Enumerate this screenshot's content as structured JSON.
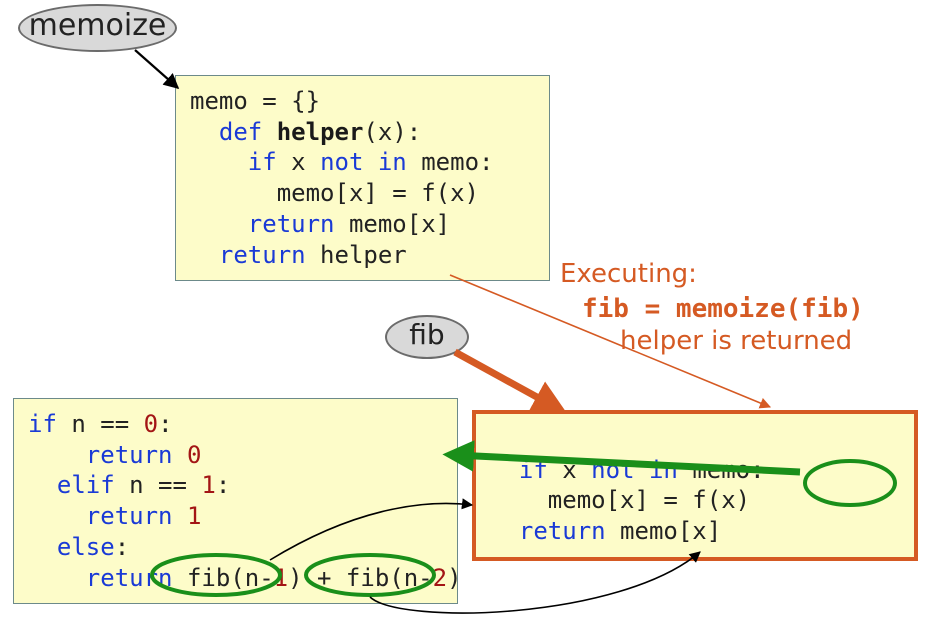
{
  "labels": {
    "memoize": "memoize",
    "fib": "fib"
  },
  "memoize_code": {
    "l1_memo": "memo",
    "l1_eq": " = {}",
    "l2_def": "def",
    "l2_name": "helper",
    "l2_params": "(x):",
    "l3_if": "if",
    "l3_x": " x ",
    "l3_notin": "not in",
    "l3_memo": " memo:",
    "l4": "memo[x] = f(x)",
    "l5_ret": "return",
    "l5_val": " memo[x]",
    "l6_ret": "return",
    "l6_val": " helper"
  },
  "fib_code": {
    "l1_if": "if",
    "l1_rest": " n == ",
    "l1_zero": "0",
    "l1_colon": ":",
    "l2_ret": "return",
    "l2_sp": " ",
    "l2_zero": "0",
    "l3_elif": "elif",
    "l3_rest": " n == ",
    "l3_one": "1",
    "l3_colon": ":",
    "l4_ret": "return",
    "l4_sp": " ",
    "l4_one": "1",
    "l5_else": "else",
    "l5_colon": ":",
    "l6_ret": "return",
    "l6_callA_pre": " fib(n-",
    "l6_callA_num": "1",
    "l6_callA_post": ")",
    "l6_plus": " + ",
    "l6_callB_pre": "fib(n-",
    "l6_callB_num": "2",
    "l6_callB_post": ")"
  },
  "helper_code": {
    "l1_if": "if",
    "l1_x": " x ",
    "l1_notin": "not in",
    "l1_memo": " memo:",
    "l2_lhs": "memo[x] = ",
    "l2_call": "f(x)",
    "l3_ret": "return",
    "l3_val": " memo[x]"
  },
  "exec": {
    "title": "Executing:",
    "code": "fib = memoize(fib)",
    "sub": "helper is returned"
  }
}
